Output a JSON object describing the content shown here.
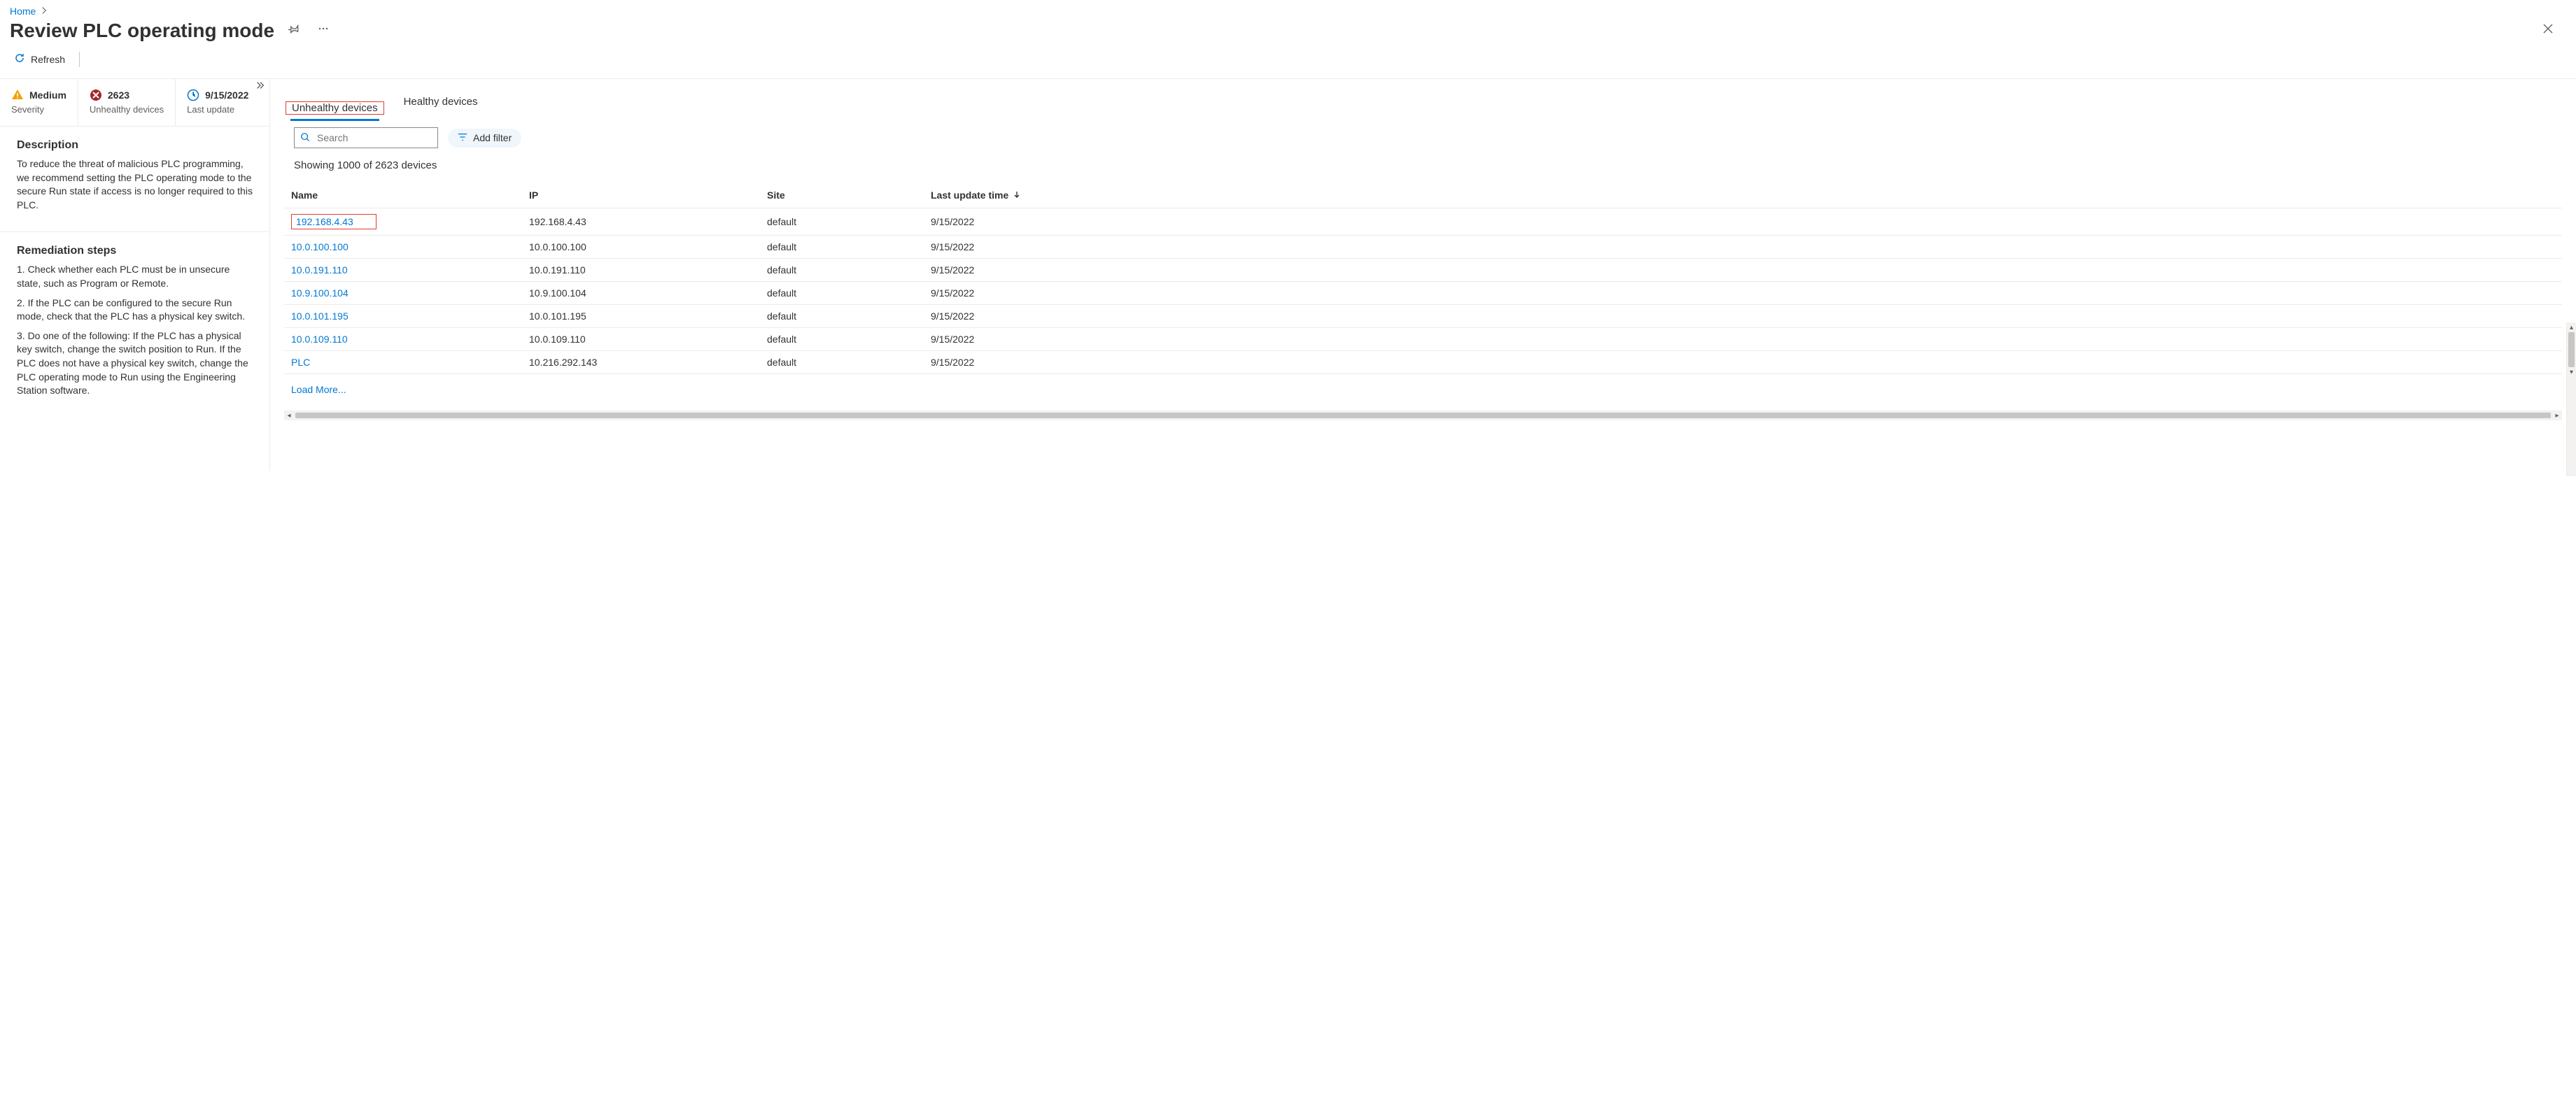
{
  "breadcrumb": {
    "home": "Home"
  },
  "page_title": "Review PLC operating mode",
  "commands": {
    "refresh": "Refresh"
  },
  "summary": {
    "severity_value": "Medium",
    "severity_label": "Severity",
    "unhealthy_value": "2623",
    "unhealthy_label": "Unhealthy devices",
    "update_value": "9/15/2022",
    "update_label": "Last update"
  },
  "side": {
    "description_h": "Description",
    "description_text": "To reduce the threat of malicious PLC programming, we recommend setting the PLC operating mode to the secure Run state if access is no longer required to this PLC.",
    "remediation_h": "Remediation steps",
    "step1": "1. Check whether each PLC must be in unsecure state, such as Program or Remote.",
    "step2": "2. If the PLC can be configured to the secure Run mode, check that the PLC has a physical key switch.",
    "step3": "3. Do one of the following: If the PLC has a physical key switch, change the switch position to Run. If the PLC does not have a physical key switch, change the PLC operating mode to Run using the Engineering Station software."
  },
  "tabs": {
    "unhealthy": "Unhealthy devices",
    "healthy": "Healthy devices"
  },
  "filters": {
    "search_placeholder": "Search",
    "add_filter": "Add filter"
  },
  "showing": "Showing 1000 of 2623 devices",
  "columns": {
    "name": "Name",
    "ip": "IP",
    "site": "Site",
    "last_update": "Last update time"
  },
  "rows": [
    {
      "name": "192.168.4.43",
      "ip": "192.168.4.43",
      "site": "default",
      "t": "9/15/2022"
    },
    {
      "name": "10.0.100.100",
      "ip": "10.0.100.100",
      "site": "default",
      "t": "9/15/2022"
    },
    {
      "name": "10.0.191.110",
      "ip": "10.0.191.110",
      "site": "default",
      "t": "9/15/2022"
    },
    {
      "name": "10.9.100.104",
      "ip": "10.9.100.104",
      "site": "default",
      "t": "9/15/2022"
    },
    {
      "name": "10.0.101.195",
      "ip": "10.0.101.195",
      "site": "default",
      "t": "9/15/2022"
    },
    {
      "name": "10.0.109.110",
      "ip": "10.0.109.110",
      "site": "default",
      "t": "9/15/2022"
    },
    {
      "name": "PLC",
      "ip": "10.216.292.143",
      "site": "default",
      "t": "9/15/2022"
    }
  ],
  "load_more": "Load More..."
}
